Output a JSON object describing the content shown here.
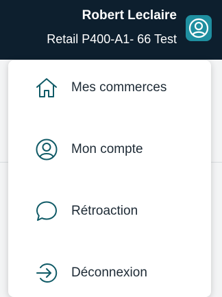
{
  "header": {
    "user_name": "Robert Leclaire",
    "store_name": "Retail P400-A1- 66 Test",
    "avatar_icon": "user-circle-icon",
    "background_color": "#0d1f2e",
    "accent_color": "#1f8fa0"
  },
  "menu": {
    "items": [
      {
        "label": "Mes commerces",
        "icon": "home-icon"
      },
      {
        "label": "Mon compte",
        "icon": "user-circle-icon"
      },
      {
        "label": "Rétroaction",
        "icon": "chat-bubble-icon"
      },
      {
        "label": "Déconnexion",
        "icon": "logout-icon"
      }
    ],
    "icon_color": "#0f5a66"
  }
}
